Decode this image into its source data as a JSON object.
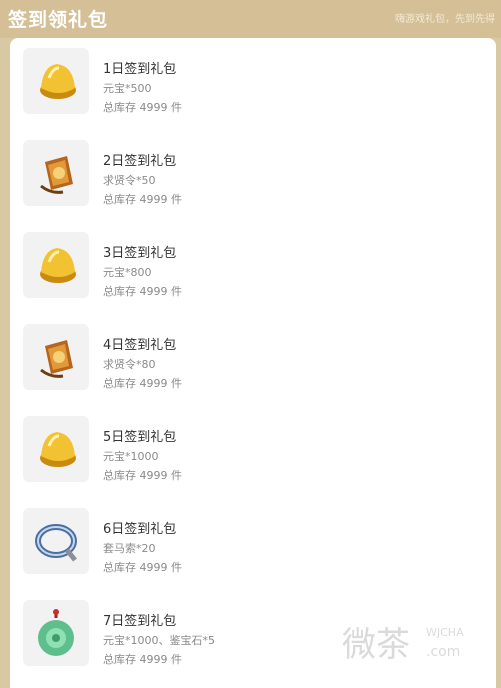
{
  "header": {
    "title": "签到领礼包",
    "subtitle": "嗨游戏礼包，先到先得"
  },
  "items": [
    {
      "name": "1日签到礼包",
      "desc": "元宝*500",
      "stock": "总库存 4999 件",
      "icon": "gold-ingot-icon"
    },
    {
      "name": "2日签到礼包",
      "desc": "求贤令*50",
      "stock": "总库存 4999 件",
      "icon": "recruit-token-icon"
    },
    {
      "name": "3日签到礼包",
      "desc": "元宝*800",
      "stock": "总库存 4999 件",
      "icon": "gold-ingot-icon"
    },
    {
      "name": "4日签到礼包",
      "desc": "求贤令*80",
      "stock": "总库存 4999 件",
      "icon": "recruit-token-icon"
    },
    {
      "name": "5日签到礼包",
      "desc": "元宝*1000",
      "stock": "总库存 4999 件",
      "icon": "gold-ingot-icon"
    },
    {
      "name": "6日签到礼包",
      "desc": "套马索*20",
      "stock": "总库存 4999 件",
      "icon": "lasso-rope-icon"
    },
    {
      "name": "7日签到礼包",
      "desc": "元宝*1000、鉴宝石*5",
      "stock": "总库存 4999 件",
      "icon": "jade-pendant-icon"
    }
  ],
  "watermark": {
    "text": "微茶",
    "latin": "WJCHA",
    "domain": ".com"
  },
  "colors": {
    "header": "#d4bf97",
    "gold": "#e8b52a",
    "jade": "#5fbf8c"
  }
}
